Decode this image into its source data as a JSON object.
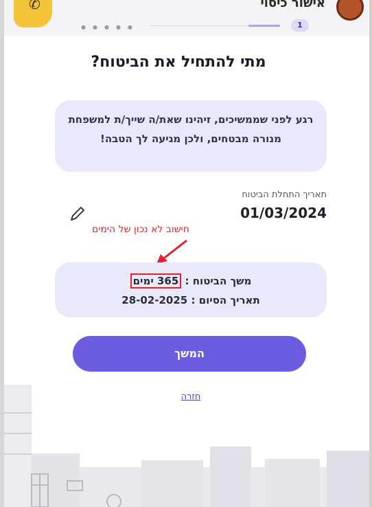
{
  "header": {
    "title": "אישור כיסוי",
    "step_number": "1",
    "logo_icon": "phone-icon"
  },
  "page": {
    "headline": "מתי להתחיל את הביטוח?",
    "info_text": "רגע לפני שממשיכים, זיהינו שאת/ה שייך/ת למשפחת מנורה מבטחים, ולכן מגיעה לך הטבה!",
    "start_date_label": "תאריך התחלת הביטוח",
    "start_date_value": "01/03/2024",
    "edit_icon": "pencil-icon"
  },
  "annotation": {
    "text": "חישוב לא נכון של הימים",
    "color": "#e2202a"
  },
  "summary": {
    "duration_label": "משך הביטוח :",
    "duration_value": "365 ימים",
    "end_label": "תאריך הסיום :",
    "end_value": "28-02-2025"
  },
  "actions": {
    "continue_label": "המשך",
    "back_label": "חזרה"
  },
  "colors": {
    "primary": "#6b5de0",
    "card_bg": "#eae9fb",
    "logo": "#f3c33a"
  }
}
